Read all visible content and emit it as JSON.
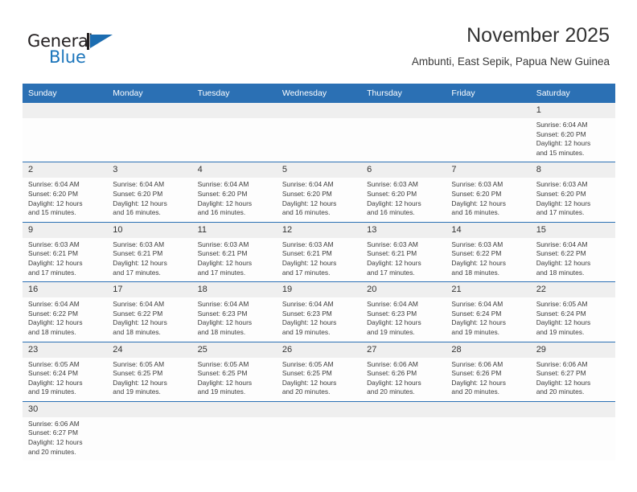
{
  "brand": {
    "name_part1": "General",
    "name_part2": "Blue",
    "logo_icon": "blue-triangle-logo",
    "accent_color": "#1b75bb"
  },
  "header": {
    "title": "November 2025",
    "subtitle": "Ambunti, East Sepik, Papua New Guinea"
  },
  "theme": {
    "header_bg": "#2b70b4",
    "daynum_bg": "#efefef",
    "row_border": "#2b70b4",
    "text": "#3c3c3c"
  },
  "calendar": {
    "weekday_headers": [
      "Sunday",
      "Monday",
      "Tuesday",
      "Wednesday",
      "Thursday",
      "Friday",
      "Saturday"
    ],
    "weeks": [
      [
        {
          "day": "",
          "empty": true,
          "sunrise": "",
          "sunset": "",
          "daylight1": "",
          "daylight2": ""
        },
        {
          "day": "",
          "empty": true,
          "sunrise": "",
          "sunset": "",
          "daylight1": "",
          "daylight2": ""
        },
        {
          "day": "",
          "empty": true,
          "sunrise": "",
          "sunset": "",
          "daylight1": "",
          "daylight2": ""
        },
        {
          "day": "",
          "empty": true,
          "sunrise": "",
          "sunset": "",
          "daylight1": "",
          "daylight2": ""
        },
        {
          "day": "",
          "empty": true,
          "sunrise": "",
          "sunset": "",
          "daylight1": "",
          "daylight2": ""
        },
        {
          "day": "",
          "empty": true,
          "sunrise": "",
          "sunset": "",
          "daylight1": "",
          "daylight2": ""
        },
        {
          "day": "1",
          "empty": false,
          "sunrise": "Sunrise: 6:04 AM",
          "sunset": "Sunset: 6:20 PM",
          "daylight1": "Daylight: 12 hours",
          "daylight2": "and 15 minutes."
        }
      ],
      [
        {
          "day": "2",
          "empty": false,
          "sunrise": "Sunrise: 6:04 AM",
          "sunset": "Sunset: 6:20 PM",
          "daylight1": "Daylight: 12 hours",
          "daylight2": "and 15 minutes."
        },
        {
          "day": "3",
          "empty": false,
          "sunrise": "Sunrise: 6:04 AM",
          "sunset": "Sunset: 6:20 PM",
          "daylight1": "Daylight: 12 hours",
          "daylight2": "and 16 minutes."
        },
        {
          "day": "4",
          "empty": false,
          "sunrise": "Sunrise: 6:04 AM",
          "sunset": "Sunset: 6:20 PM",
          "daylight1": "Daylight: 12 hours",
          "daylight2": "and 16 minutes."
        },
        {
          "day": "5",
          "empty": false,
          "sunrise": "Sunrise: 6:04 AM",
          "sunset": "Sunset: 6:20 PM",
          "daylight1": "Daylight: 12 hours",
          "daylight2": "and 16 minutes."
        },
        {
          "day": "6",
          "empty": false,
          "sunrise": "Sunrise: 6:03 AM",
          "sunset": "Sunset: 6:20 PM",
          "daylight1": "Daylight: 12 hours",
          "daylight2": "and 16 minutes."
        },
        {
          "day": "7",
          "empty": false,
          "sunrise": "Sunrise: 6:03 AM",
          "sunset": "Sunset: 6:20 PM",
          "daylight1": "Daylight: 12 hours",
          "daylight2": "and 16 minutes."
        },
        {
          "day": "8",
          "empty": false,
          "sunrise": "Sunrise: 6:03 AM",
          "sunset": "Sunset: 6:20 PM",
          "daylight1": "Daylight: 12 hours",
          "daylight2": "and 17 minutes."
        }
      ],
      [
        {
          "day": "9",
          "empty": false,
          "sunrise": "Sunrise: 6:03 AM",
          "sunset": "Sunset: 6:21 PM",
          "daylight1": "Daylight: 12 hours",
          "daylight2": "and 17 minutes."
        },
        {
          "day": "10",
          "empty": false,
          "sunrise": "Sunrise: 6:03 AM",
          "sunset": "Sunset: 6:21 PM",
          "daylight1": "Daylight: 12 hours",
          "daylight2": "and 17 minutes."
        },
        {
          "day": "11",
          "empty": false,
          "sunrise": "Sunrise: 6:03 AM",
          "sunset": "Sunset: 6:21 PM",
          "daylight1": "Daylight: 12 hours",
          "daylight2": "and 17 minutes."
        },
        {
          "day": "12",
          "empty": false,
          "sunrise": "Sunrise: 6:03 AM",
          "sunset": "Sunset: 6:21 PM",
          "daylight1": "Daylight: 12 hours",
          "daylight2": "and 17 minutes."
        },
        {
          "day": "13",
          "empty": false,
          "sunrise": "Sunrise: 6:03 AM",
          "sunset": "Sunset: 6:21 PM",
          "daylight1": "Daylight: 12 hours",
          "daylight2": "and 17 minutes."
        },
        {
          "day": "14",
          "empty": false,
          "sunrise": "Sunrise: 6:03 AM",
          "sunset": "Sunset: 6:22 PM",
          "daylight1": "Daylight: 12 hours",
          "daylight2": "and 18 minutes."
        },
        {
          "day": "15",
          "empty": false,
          "sunrise": "Sunrise: 6:04 AM",
          "sunset": "Sunset: 6:22 PM",
          "daylight1": "Daylight: 12 hours",
          "daylight2": "and 18 minutes."
        }
      ],
      [
        {
          "day": "16",
          "empty": false,
          "sunrise": "Sunrise: 6:04 AM",
          "sunset": "Sunset: 6:22 PM",
          "daylight1": "Daylight: 12 hours",
          "daylight2": "and 18 minutes."
        },
        {
          "day": "17",
          "empty": false,
          "sunrise": "Sunrise: 6:04 AM",
          "sunset": "Sunset: 6:22 PM",
          "daylight1": "Daylight: 12 hours",
          "daylight2": "and 18 minutes."
        },
        {
          "day": "18",
          "empty": false,
          "sunrise": "Sunrise: 6:04 AM",
          "sunset": "Sunset: 6:23 PM",
          "daylight1": "Daylight: 12 hours",
          "daylight2": "and 18 minutes."
        },
        {
          "day": "19",
          "empty": false,
          "sunrise": "Sunrise: 6:04 AM",
          "sunset": "Sunset: 6:23 PM",
          "daylight1": "Daylight: 12 hours",
          "daylight2": "and 19 minutes."
        },
        {
          "day": "20",
          "empty": false,
          "sunrise": "Sunrise: 6:04 AM",
          "sunset": "Sunset: 6:23 PM",
          "daylight1": "Daylight: 12 hours",
          "daylight2": "and 19 minutes."
        },
        {
          "day": "21",
          "empty": false,
          "sunrise": "Sunrise: 6:04 AM",
          "sunset": "Sunset: 6:24 PM",
          "daylight1": "Daylight: 12 hours",
          "daylight2": "and 19 minutes."
        },
        {
          "day": "22",
          "empty": false,
          "sunrise": "Sunrise: 6:05 AM",
          "sunset": "Sunset: 6:24 PM",
          "daylight1": "Daylight: 12 hours",
          "daylight2": "and 19 minutes."
        }
      ],
      [
        {
          "day": "23",
          "empty": false,
          "sunrise": "Sunrise: 6:05 AM",
          "sunset": "Sunset: 6:24 PM",
          "daylight1": "Daylight: 12 hours",
          "daylight2": "and 19 minutes."
        },
        {
          "day": "24",
          "empty": false,
          "sunrise": "Sunrise: 6:05 AM",
          "sunset": "Sunset: 6:25 PM",
          "daylight1": "Daylight: 12 hours",
          "daylight2": "and 19 minutes."
        },
        {
          "day": "25",
          "empty": false,
          "sunrise": "Sunrise: 6:05 AM",
          "sunset": "Sunset: 6:25 PM",
          "daylight1": "Daylight: 12 hours",
          "daylight2": "and 19 minutes."
        },
        {
          "day": "26",
          "empty": false,
          "sunrise": "Sunrise: 6:05 AM",
          "sunset": "Sunset: 6:25 PM",
          "daylight1": "Daylight: 12 hours",
          "daylight2": "and 20 minutes."
        },
        {
          "day": "27",
          "empty": false,
          "sunrise": "Sunrise: 6:06 AM",
          "sunset": "Sunset: 6:26 PM",
          "daylight1": "Daylight: 12 hours",
          "daylight2": "and 20 minutes."
        },
        {
          "day": "28",
          "empty": false,
          "sunrise": "Sunrise: 6:06 AM",
          "sunset": "Sunset: 6:26 PM",
          "daylight1": "Daylight: 12 hours",
          "daylight2": "and 20 minutes."
        },
        {
          "day": "29",
          "empty": false,
          "sunrise": "Sunrise: 6:06 AM",
          "sunset": "Sunset: 6:27 PM",
          "daylight1": "Daylight: 12 hours",
          "daylight2": "and 20 minutes."
        }
      ],
      [
        {
          "day": "30",
          "empty": false,
          "sunrise": "Sunrise: 6:06 AM",
          "sunset": "Sunset: 6:27 PM",
          "daylight1": "Daylight: 12 hours",
          "daylight2": "and 20 minutes."
        },
        {
          "day": "",
          "empty": true,
          "sunrise": "",
          "sunset": "",
          "daylight1": "",
          "daylight2": ""
        },
        {
          "day": "",
          "empty": true,
          "sunrise": "",
          "sunset": "",
          "daylight1": "",
          "daylight2": ""
        },
        {
          "day": "",
          "empty": true,
          "sunrise": "",
          "sunset": "",
          "daylight1": "",
          "daylight2": ""
        },
        {
          "day": "",
          "empty": true,
          "sunrise": "",
          "sunset": "",
          "daylight1": "",
          "daylight2": ""
        },
        {
          "day": "",
          "empty": true,
          "sunrise": "",
          "sunset": "",
          "daylight1": "",
          "daylight2": ""
        },
        {
          "day": "",
          "empty": true,
          "sunrise": "",
          "sunset": "",
          "daylight1": "",
          "daylight2": ""
        }
      ]
    ]
  }
}
